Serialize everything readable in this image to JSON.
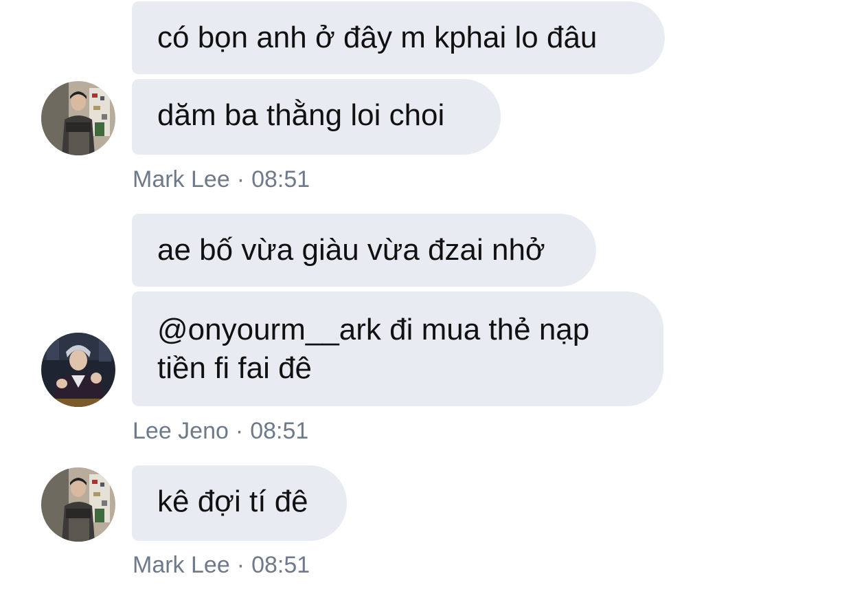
{
  "groups": [
    {
      "sender": "Mark Lee",
      "time": "08:51",
      "messages": [
        "có bọn anh ở đây m kphai lo đâu",
        "dăm ba thằng loi choi"
      ]
    },
    {
      "sender": "Lee Jeno",
      "time": "08:51",
      "messages": [
        "ae bố vừa giàu vừa đzai nhở",
        "@onyourm__ark đi mua thẻ nạp tiền fi fai đê"
      ]
    },
    {
      "sender": "Mark Lee",
      "time": "08:51",
      "messages": [
        "kê đợi tí đê"
      ]
    }
  ],
  "colors": {
    "bubble_background": "#e8ecf2",
    "bubble_text": "#111111",
    "meta_text": "#6e7a8a",
    "page_background": "#ffffff"
  },
  "icons": {
    "avatar_mark": "user-avatar-photo-mark-lee",
    "avatar_jeno": "user-avatar-photo-lee-jeno"
  },
  "separator": "·"
}
